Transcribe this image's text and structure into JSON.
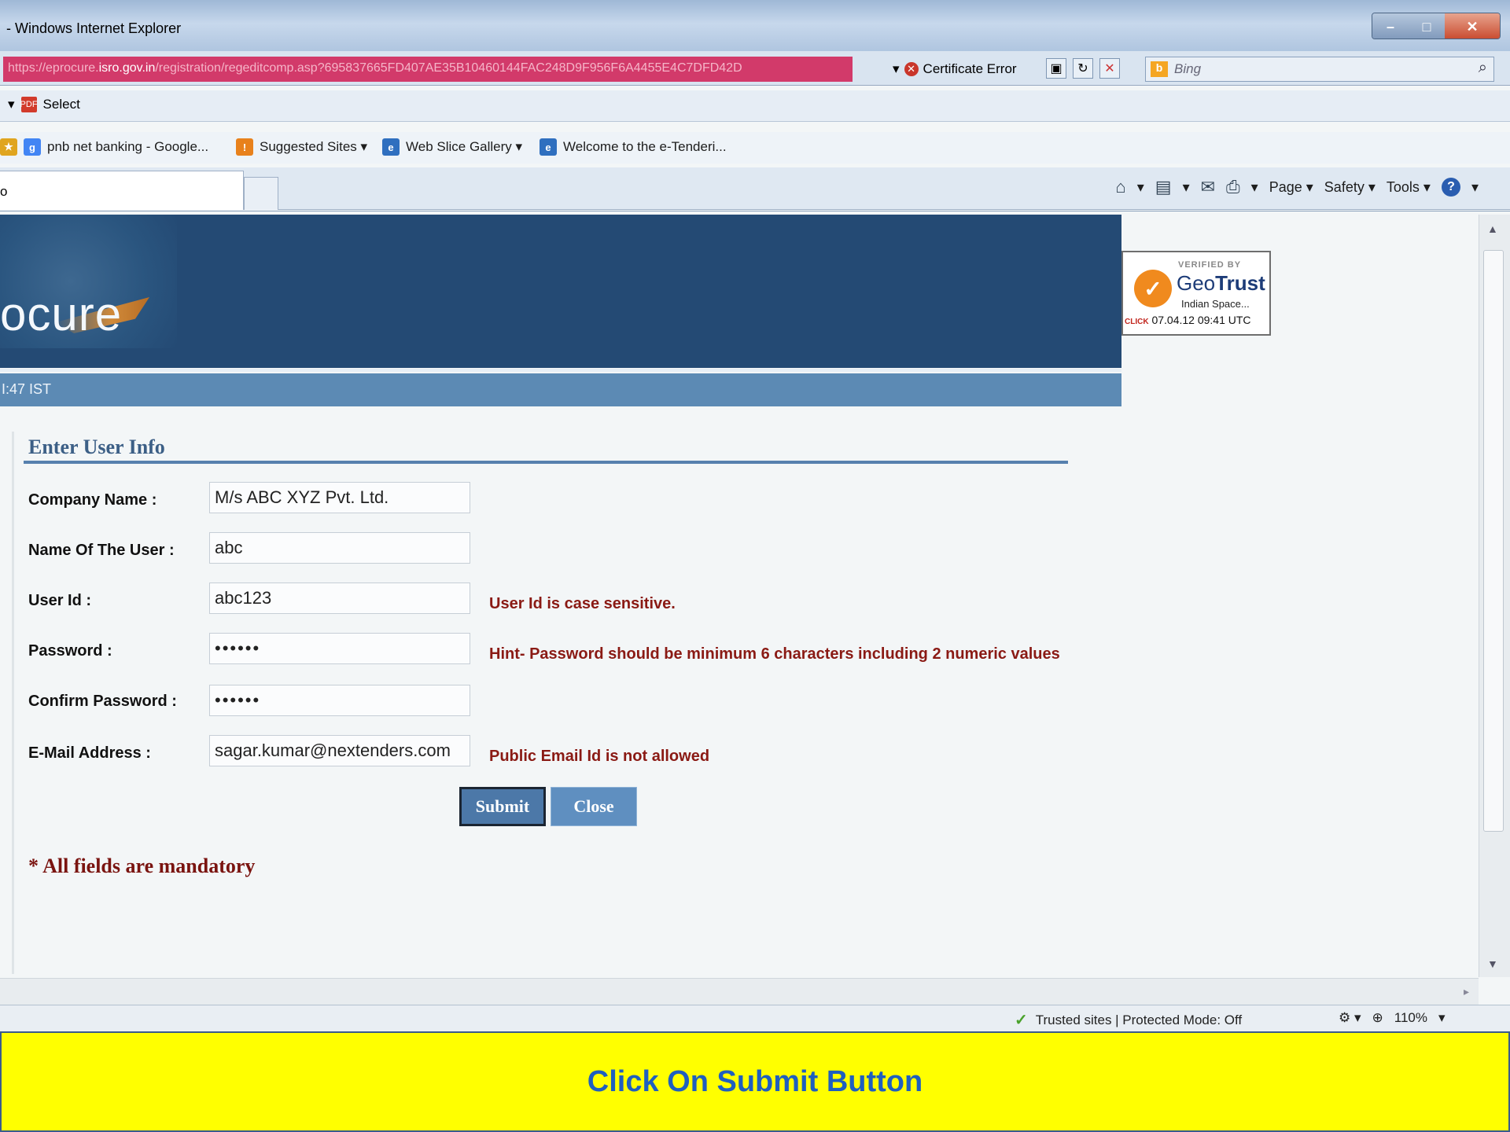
{
  "window": {
    "title": "- Windows Internet Explorer"
  },
  "address_bar": {
    "url_prefix": "https://eprocure.",
    "url_domain": "isro.gov.in",
    "url_path": "/registration/regeditcomp.asp?695837665FD407AE35B10460144FAC248D9F956F6A4455E4C7DFD42D",
    "certificate_error": "Certificate Error",
    "search_placeholder": "Bing"
  },
  "command": {
    "select_label": "Select"
  },
  "favorites": [
    {
      "label": "pnb net banking - Google..."
    },
    {
      "label": "Suggested Sites ▾"
    },
    {
      "label": "Web Slice Gallery ▾"
    },
    {
      "label": "Welcome to the e-Tenderi..."
    }
  ],
  "tab": {
    "title": "o"
  },
  "toolbar": {
    "page": "Page",
    "safety": "Safety",
    "tools": "Tools"
  },
  "banner": {
    "logo_text": "ocure",
    "time_text": "I:47  IST"
  },
  "geotrust": {
    "verified": "VERIFIED BY",
    "brand_geo": "Geo",
    "brand_trust": "Trust",
    "org": "Indian Space...",
    "click": "CLICK",
    "date": "07.04.12 09:41 UTC"
  },
  "form": {
    "heading": "Enter User Info",
    "fields": [
      {
        "label": "Company Name :",
        "value": "M/s ABC XYZ Pvt. Ltd."
      },
      {
        "label": "Name Of The User :",
        "value": "abc"
      },
      {
        "label": "User Id :",
        "value": "abc123",
        "hint": "User Id is case sensitive."
      },
      {
        "label": "Password :",
        "value": "••••••",
        "hint": "Hint-  Password should be minimum 6 characters including 2 numeric values"
      },
      {
        "label": "Confirm Password :",
        "value": "••••••"
      },
      {
        "label": "E-Mail Address :",
        "value": "sagar.kumar@nextenders.com",
        "hint": "Public Email Id is not allowed"
      }
    ],
    "submit_label": "Submit",
    "close_label": "Close",
    "mandatory_note": "* All fields are mandatory"
  },
  "statusbar": {
    "zone": "Trusted sites | Protected Mode: Off",
    "zoom": "110%"
  },
  "caption": {
    "text": "Click On Submit Button"
  },
  "colors": {
    "banner": "#244a74",
    "caption_bg": "#ffff00",
    "caption_text": "#1f5fbf",
    "hint": "#8a1a14"
  }
}
